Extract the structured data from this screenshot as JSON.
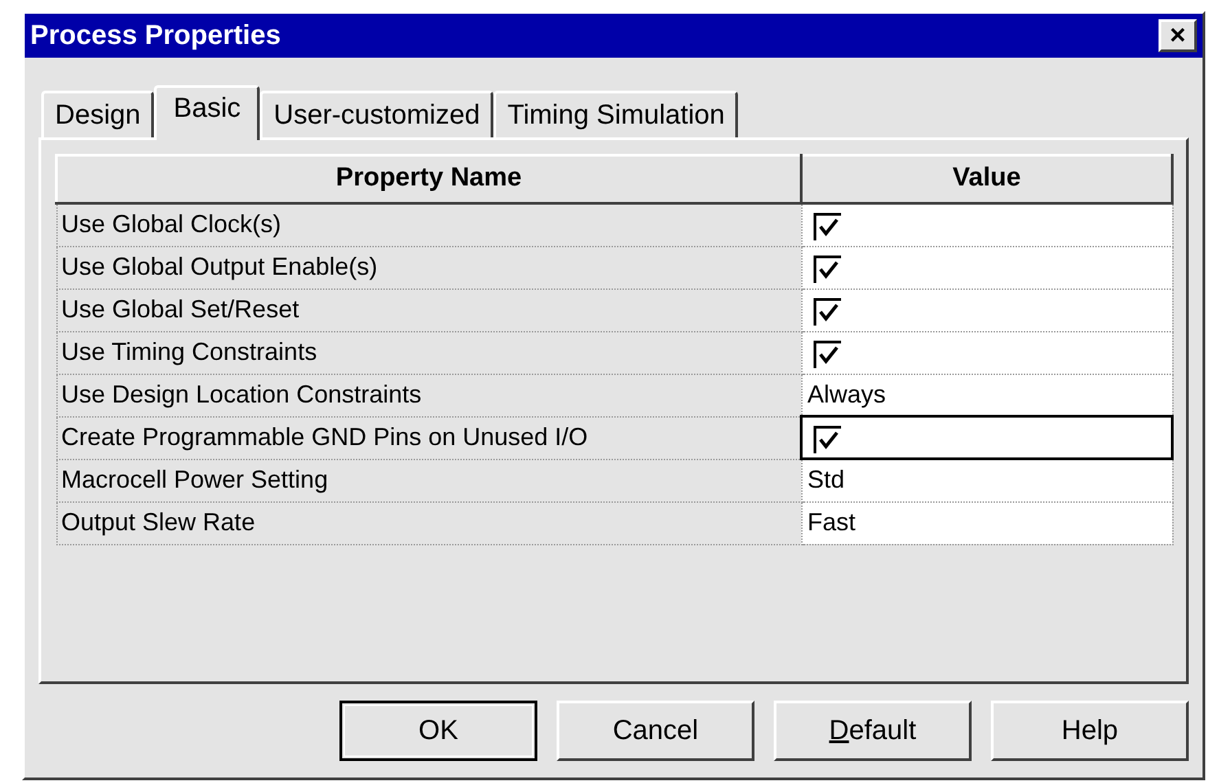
{
  "window": {
    "title": "Process Properties",
    "close": "×"
  },
  "tabs": [
    {
      "label": "Design",
      "selected": false
    },
    {
      "label": "Basic",
      "selected": true
    },
    {
      "label": "User-customized",
      "selected": false
    },
    {
      "label": "Timing Simulation",
      "selected": false
    }
  ],
  "table": {
    "columns": [
      "Property Name",
      "Value"
    ],
    "rows": [
      {
        "name": "Use Global Clock(s)",
        "kind": "checkbox",
        "checked": true,
        "focused": false
      },
      {
        "name": "Use Global Output Enable(s)",
        "kind": "checkbox",
        "checked": true,
        "focused": false
      },
      {
        "name": "Use Global Set/Reset",
        "kind": "checkbox",
        "checked": true,
        "focused": false
      },
      {
        "name": "Use Timing Constraints",
        "kind": "checkbox",
        "checked": true,
        "focused": false
      },
      {
        "name": "Use Design Location Constraints",
        "kind": "text",
        "value": "Always",
        "focused": false
      },
      {
        "name": "Create Programmable GND Pins on Unused I/O",
        "kind": "checkbox",
        "checked": true,
        "focused": true
      },
      {
        "name": "Macrocell Power Setting",
        "kind": "text",
        "value": "Std",
        "focused": false
      },
      {
        "name": "Output Slew Rate",
        "kind": "text",
        "value": "Fast",
        "focused": false
      }
    ]
  },
  "buttons": [
    {
      "label": "OK",
      "default": true
    },
    {
      "label": "Cancel",
      "default": false
    },
    {
      "label": "Default",
      "default": false,
      "first_letter_underlined": true
    },
    {
      "label": "Help",
      "default": false
    }
  ]
}
